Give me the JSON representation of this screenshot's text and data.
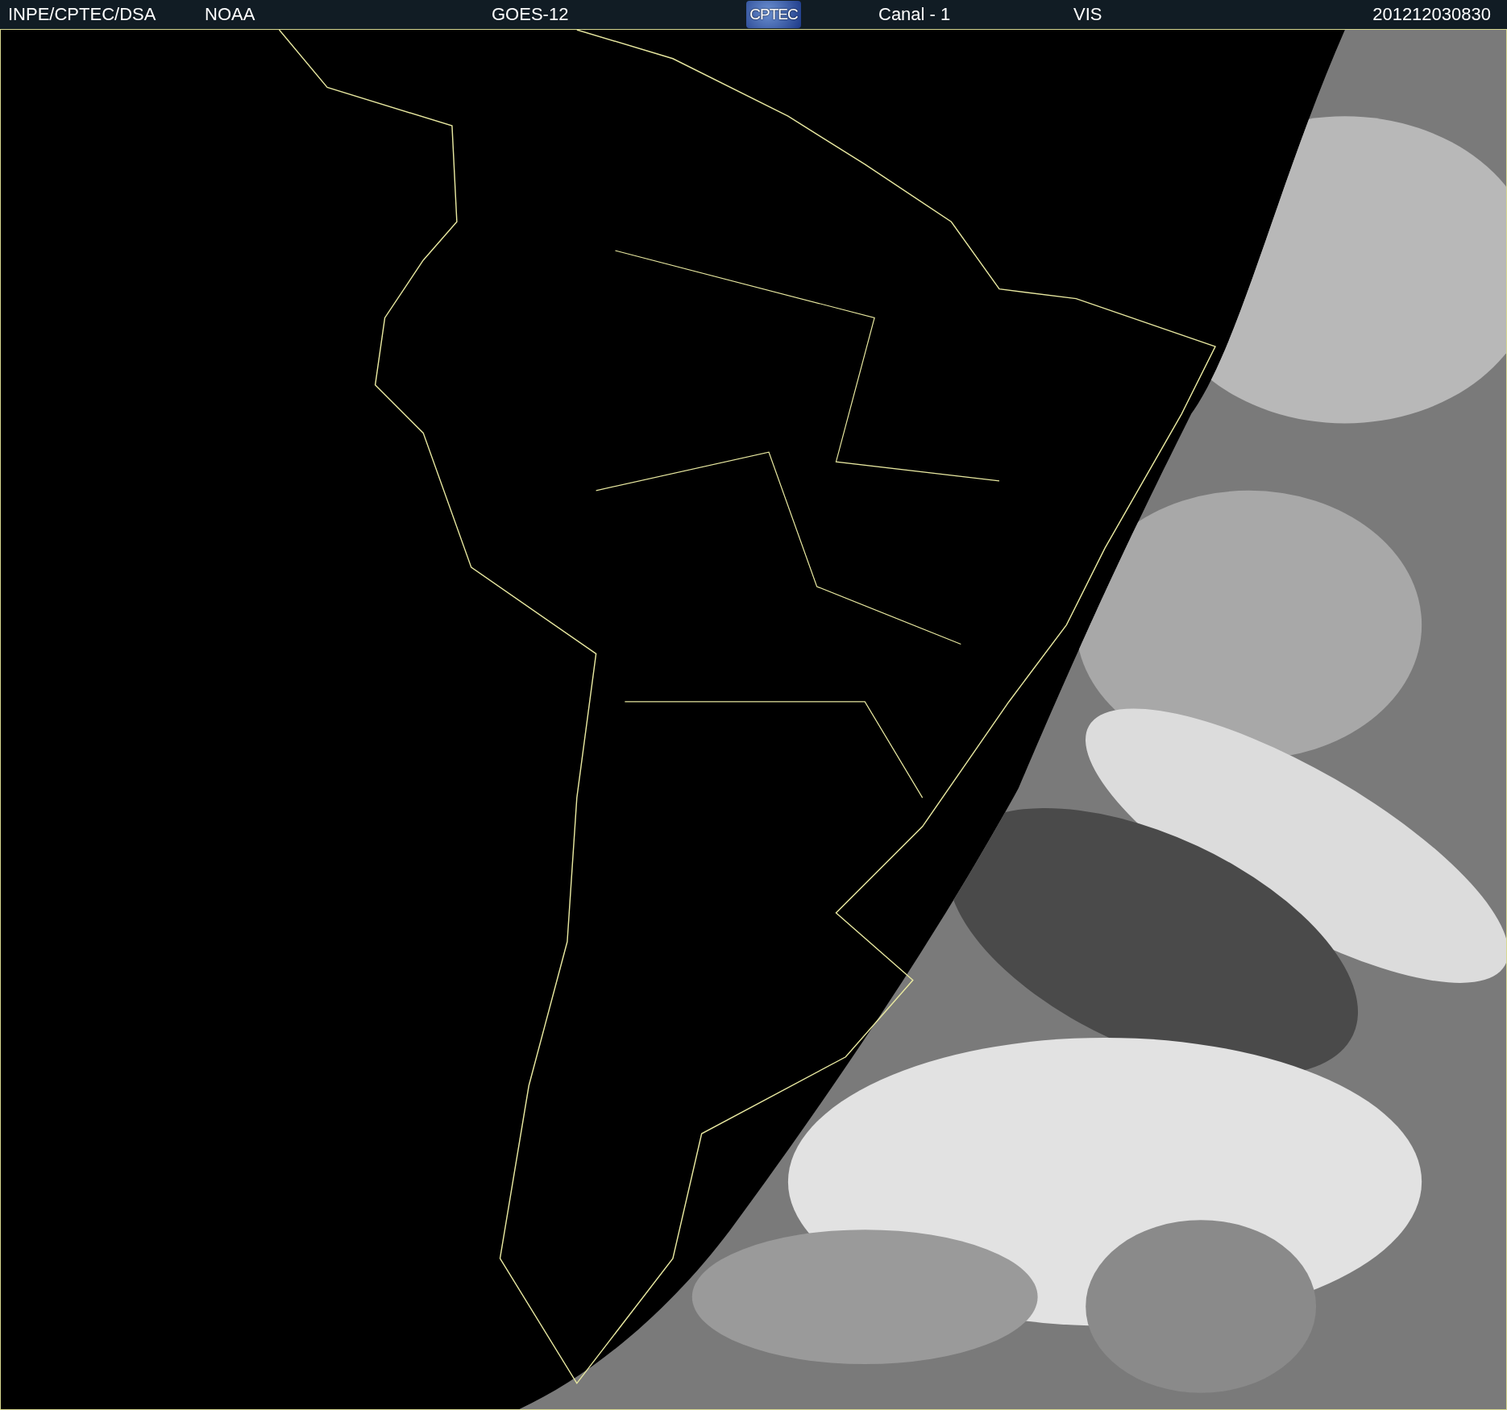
{
  "header": {
    "source": "INPE/CPTEC/DSA",
    "agency": "NOAA",
    "satellite": "GOES-12",
    "logo": "CPTEC",
    "channel": "Canal - 1",
    "band": "VIS",
    "timestamp": "201212030830"
  }
}
